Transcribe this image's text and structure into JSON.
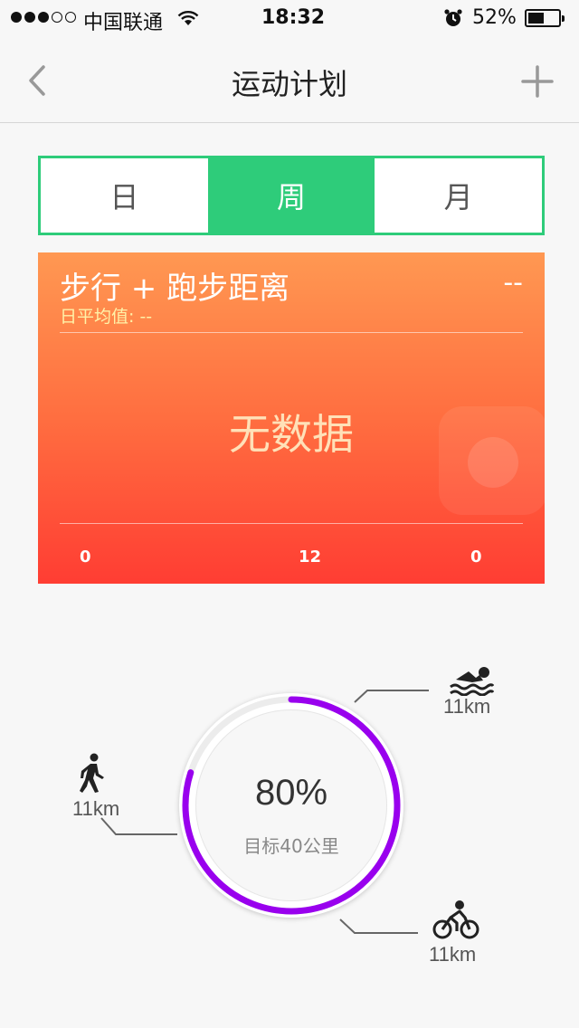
{
  "status_bar": {
    "carrier": "中国联通",
    "time": "18:32",
    "battery": "52%",
    "battery_level": 0.52
  },
  "nav": {
    "title": "运动计划",
    "back_icon": "chevron-left-icon",
    "add_icon": "plus-icon"
  },
  "tabs": [
    {
      "label": "日",
      "active": false
    },
    {
      "label": "周",
      "active": true
    },
    {
      "label": "月",
      "active": false
    }
  ],
  "card": {
    "title": "步行 + 跑步距离",
    "subtitle": "日平均值: --",
    "value": "--",
    "empty_text": "无数据",
    "axis_ticks": [
      "0",
      "12",
      "0"
    ],
    "gradient_top": "#ff9852",
    "gradient_bottom": "#ff3d33"
  },
  "progress": {
    "percent_label": "80%",
    "goal_label": "目标40公里",
    "fraction": 0.8,
    "ring_color": "#9900ee"
  },
  "activities": {
    "swim": {
      "value": "11km",
      "icon": "swimming-icon"
    },
    "walk": {
      "value": "11km",
      "icon": "walking-icon"
    },
    "cycle": {
      "value": "11km",
      "icon": "cycling-icon"
    }
  }
}
